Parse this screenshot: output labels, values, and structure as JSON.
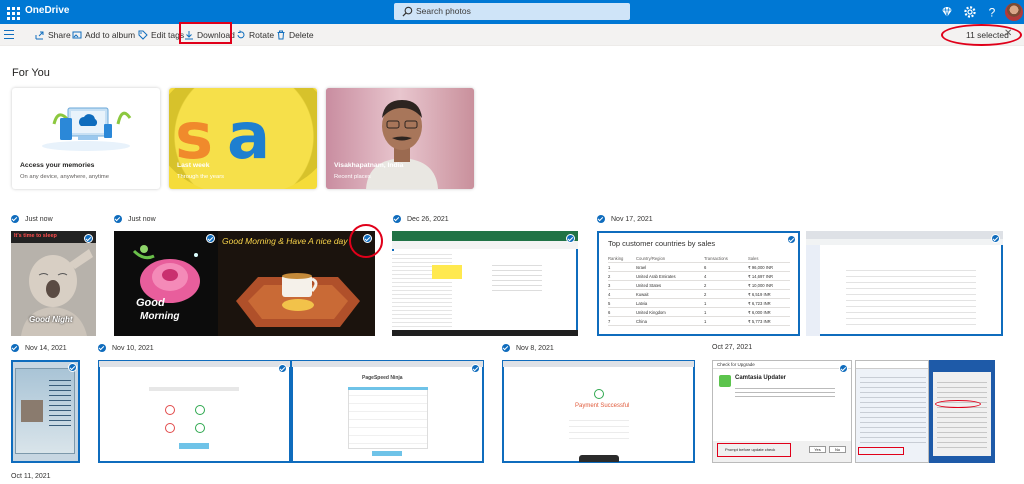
{
  "app": {
    "brand": "OneDrive",
    "search_placeholder": "Search photos",
    "icons": [
      "waffle-icon",
      "diamond-icon",
      "gear-icon",
      "help-icon"
    ]
  },
  "commands": {
    "share": "Share",
    "add_to_album": "Add to album",
    "edit_tags": "Edit tags",
    "download": "Download",
    "rotate": "Rotate",
    "delete": "Delete",
    "selected_count": "11 selected",
    "close": "✕"
  },
  "foryou": {
    "heading": "For You",
    "cards": [
      {
        "title": "Access your memories",
        "subtitle": "On any device, anywhere, anytime"
      },
      {
        "title": "Last week",
        "subtitle": "Through the years"
      },
      {
        "title": "Visakhapatnam, India",
        "subtitle": "Recent places"
      }
    ]
  },
  "groups": {
    "g1": "Just now",
    "g2": "Just now",
    "g3": "Dec 26, 2021",
    "g4": "Nov 17, 2021",
    "g5": "Nov 14, 2021",
    "g6": "Nov 10, 2021",
    "g7": "Nov 8, 2021",
    "g8": "Oct 27, 2021",
    "g9": "Oct 11, 2021"
  },
  "photos": {
    "good_night": "Good Night",
    "good_night_top": "It's time to sleep",
    "good_morning": "Good",
    "good_morning2": "Morning",
    "have_a_nice": "Good Morning & Have A nice day",
    "sales_title": "Top customer countries by sales",
    "sales_headers": [
      "Ranking",
      "Country/Region",
      "Transactions",
      "Sales"
    ],
    "sales_rows": [
      [
        "1",
        "Israel",
        "6",
        "₹ 96,000 INR"
      ],
      [
        "2",
        "United Arab Emirates",
        "4",
        "₹ 14,697 INR"
      ],
      [
        "3",
        "United States",
        "2",
        "₹ 10,000 INR"
      ],
      [
        "4",
        "Kuwait",
        "2",
        "₹ 6,519 INR"
      ],
      [
        "5",
        "Latvia",
        "1",
        "₹ 6,723 INR"
      ],
      [
        "6",
        "United Kingdom",
        "1",
        "₹ 6,000 INR"
      ],
      [
        "7",
        "China",
        "1",
        "₹ 5,773 INR"
      ]
    ],
    "payment": "Payment Successful",
    "camtasia_title": "Camtasia Updater",
    "check_upgrade": "Check for Upgrade",
    "prompt_before": "Prompt before update check",
    "yes": "Yes",
    "no": "No",
    "pageproof": "PageSpeed Ninja"
  },
  "colors": {
    "accent": "#0078d4",
    "selection": "#0f6cbd",
    "annotation_red": "#e0001a",
    "command_bar": "#f3f2f1"
  }
}
